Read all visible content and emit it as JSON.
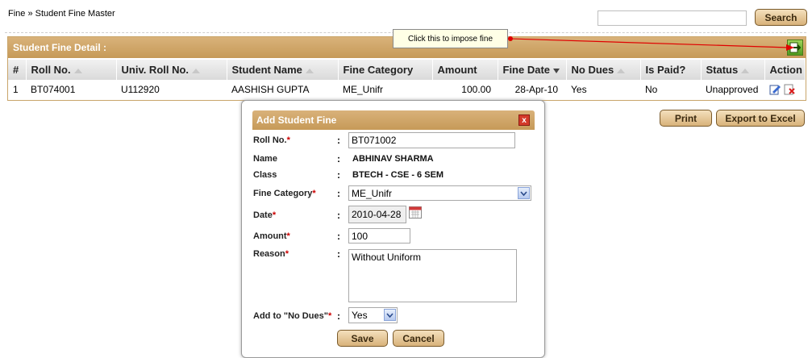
{
  "breadcrumb": "Fine » Student Fine Master",
  "search": {
    "button": "Search",
    "value": ""
  },
  "callout": "Click this to impose fine",
  "panel": {
    "title": "Student Fine Detail :"
  },
  "table": {
    "columns": [
      "#",
      "Roll No.",
      "Univ. Roll No.",
      "Student Name",
      "Fine Category",
      "Amount",
      "Fine Date",
      "No Dues",
      "Is Paid?",
      "Status",
      "Action"
    ],
    "rows": [
      {
        "num": "1",
        "roll": "BT074001",
        "univ": "U112920",
        "name": "AASHISH GUPTA",
        "category": "ME_Unifr",
        "amount": "100.00",
        "date": "28-Apr-10",
        "nodues": "Yes",
        "paid": "No",
        "status": "Unapproved"
      }
    ]
  },
  "buttons": {
    "print": "Print",
    "excel": "Export to Excel"
  },
  "dialog": {
    "title": "Add Student Fine",
    "close": "x",
    "labels": {
      "roll": "Roll No.",
      "name": "Name",
      "class": "Class",
      "category": "Fine Category",
      "date": "Date",
      "amount": "Amount",
      "reason": "Reason",
      "nodues": "Add to \"No Dues\""
    },
    "colon": ":",
    "req": "*",
    "values": {
      "roll": "BT071002",
      "name": "ABHINAV SHARMA",
      "class": "BTECH - CSE - 6 SEM",
      "category": "ME_Unifr",
      "date": "2010-04-28",
      "amount": "100",
      "reason": "Without Uniform",
      "nodues": "Yes"
    },
    "save": "Save",
    "cancel": "Cancel"
  },
  "colors": {
    "accent": "#c69a58",
    "required": "#cc0000",
    "arrow": "#e00000"
  }
}
